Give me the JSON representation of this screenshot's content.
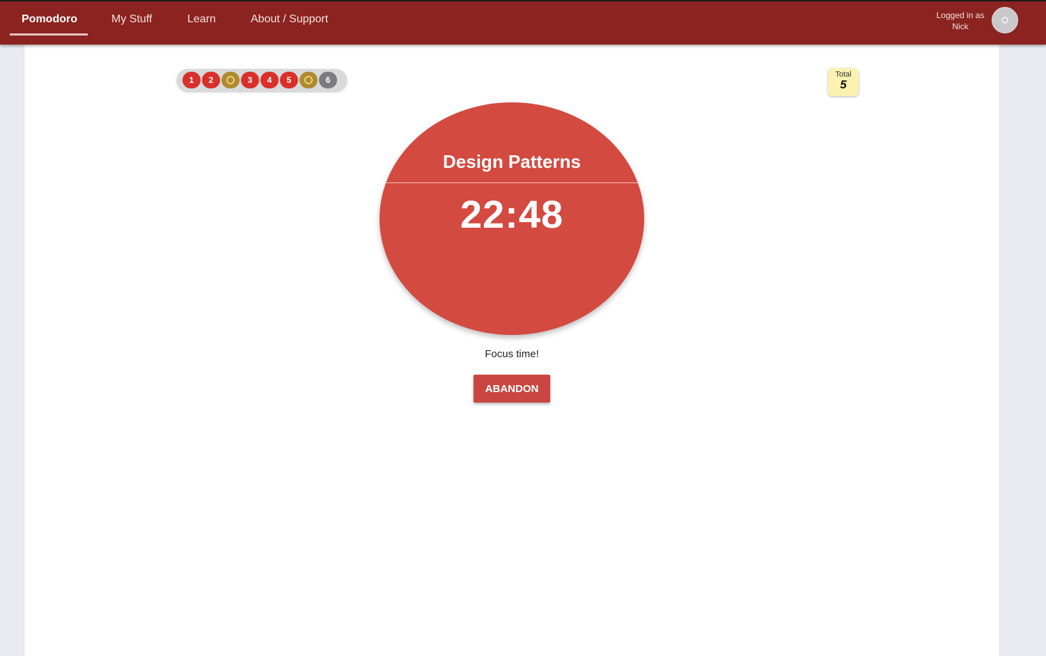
{
  "nav": {
    "items": [
      {
        "label": "Pomodoro",
        "active": true
      },
      {
        "label": "My Stuff",
        "active": false
      },
      {
        "label": "Learn",
        "active": false
      },
      {
        "label": "About / Support",
        "active": false
      }
    ]
  },
  "user": {
    "line1": "Logged in as",
    "line2": "Nick",
    "avatar_icon": "power-icon"
  },
  "session_pills": [
    {
      "type": "work",
      "label": "1"
    },
    {
      "type": "work",
      "label": "2"
    },
    {
      "type": "break",
      "label": "",
      "icon": "break-icon"
    },
    {
      "type": "work",
      "label": "3"
    },
    {
      "type": "work",
      "label": "4"
    },
    {
      "type": "work",
      "label": "5"
    },
    {
      "type": "break",
      "label": "",
      "icon": "break-icon"
    },
    {
      "type": "pending",
      "label": "6"
    }
  ],
  "total": {
    "label": "Total",
    "value": "5"
  },
  "timer": {
    "task": "Design Patterns",
    "time": "22:48"
  },
  "status_text": "Focus time!",
  "abandon_label": "ABANDON",
  "colors": {
    "topbar": "#8b2320",
    "timer": "#d34a40",
    "work_pill": "#d9302a",
    "break_pill": "#b08a2f",
    "pending_pill": "#7c7c7f",
    "total_badge": "#fbf2b1"
  }
}
